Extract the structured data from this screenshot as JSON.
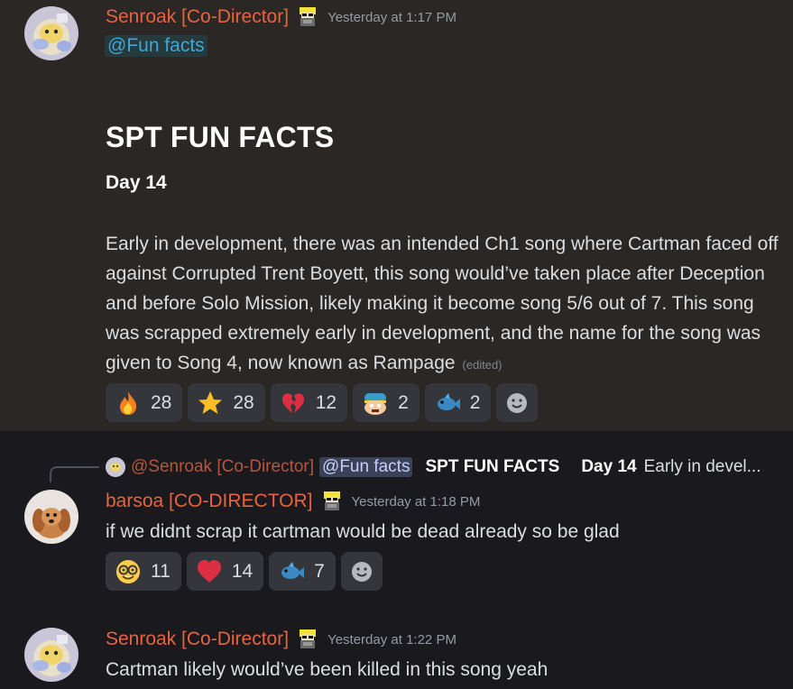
{
  "messages": [
    {
      "author": "Senroak [Co-Director]",
      "timestamp": "Yesterday at 1:17 PM",
      "mention": "@Fun facts",
      "heading": "SPT FUN FACTS",
      "subheading": "Day 14",
      "body": "Early in development, there was an intended Ch1 song where Cartman faced off against Corrupted Trent Boyett, this song would’ve taken place after Deception and before Solo Mission, likely making it become song 5/6 out of 7. This song was scrapped extremely early in development, and the name for the song was given to Song 4, now known as Rampage",
      "edited": "(edited)",
      "reactions": [
        {
          "emoji": "fire-emoji",
          "count": "28"
        },
        {
          "emoji": "star-emoji",
          "count": "28"
        },
        {
          "emoji": "broken-heart-emoji",
          "count": "12"
        },
        {
          "emoji": "cartman-custom-emoji",
          "count": "2"
        },
        {
          "emoji": "fish-emoji",
          "count": "2"
        }
      ]
    },
    {
      "reply": {
        "author": "@Senroak [Co-Director]",
        "mention": "@Fun facts",
        "bold1": "SPT FUN FACTS",
        "bold2": "Day 14",
        "text": "Early in devel..."
      },
      "author": "barsoa [CO-DIRECTOR]",
      "timestamp": "Yesterday at 1:18 PM",
      "body": "if we didnt scrap it cartman would be dead already so be glad",
      "reactions": [
        {
          "emoji": "nerd-face-emoji",
          "count": "11"
        },
        {
          "emoji": "red-heart-emoji",
          "count": "14"
        },
        {
          "emoji": "fish-emoji",
          "count": "7"
        }
      ]
    },
    {
      "author": "Senroak [Co-Director]",
      "timestamp": "Yesterday at 1:22 PM",
      "body": "Cartman likely would’ve been killed in this song yeah"
    }
  ],
  "colors": {
    "username": "#e8633f",
    "mention_bg": "#3a4257",
    "highlight_bg": "#2a2725"
  }
}
